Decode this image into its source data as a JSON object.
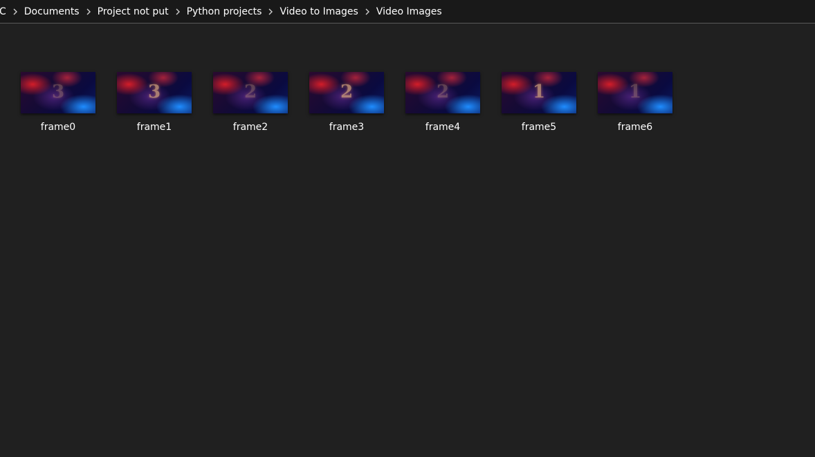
{
  "breadcrumb": {
    "items": [
      {
        "label": "C"
      },
      {
        "label": "Documents"
      },
      {
        "label": "Project not put"
      },
      {
        "label": "Python projects"
      },
      {
        "label": "Video to Images"
      },
      {
        "label": "Video Images"
      }
    ]
  },
  "files": [
    {
      "name": "frame0",
      "thumb_digit": "3",
      "faint": true
    },
    {
      "name": "frame1",
      "thumb_digit": "3",
      "faint": false
    },
    {
      "name": "frame2",
      "thumb_digit": "2",
      "faint": true
    },
    {
      "name": "frame3",
      "thumb_digit": "2",
      "faint": false
    },
    {
      "name": "frame4",
      "thumb_digit": "2",
      "faint": true
    },
    {
      "name": "frame5",
      "thumb_digit": "1",
      "faint": false
    },
    {
      "name": "frame6",
      "thumb_digit": "1",
      "faint": true
    }
  ],
  "colors": {
    "background": "#202020",
    "addressbar": "#191919",
    "text": "#ffffff"
  }
}
